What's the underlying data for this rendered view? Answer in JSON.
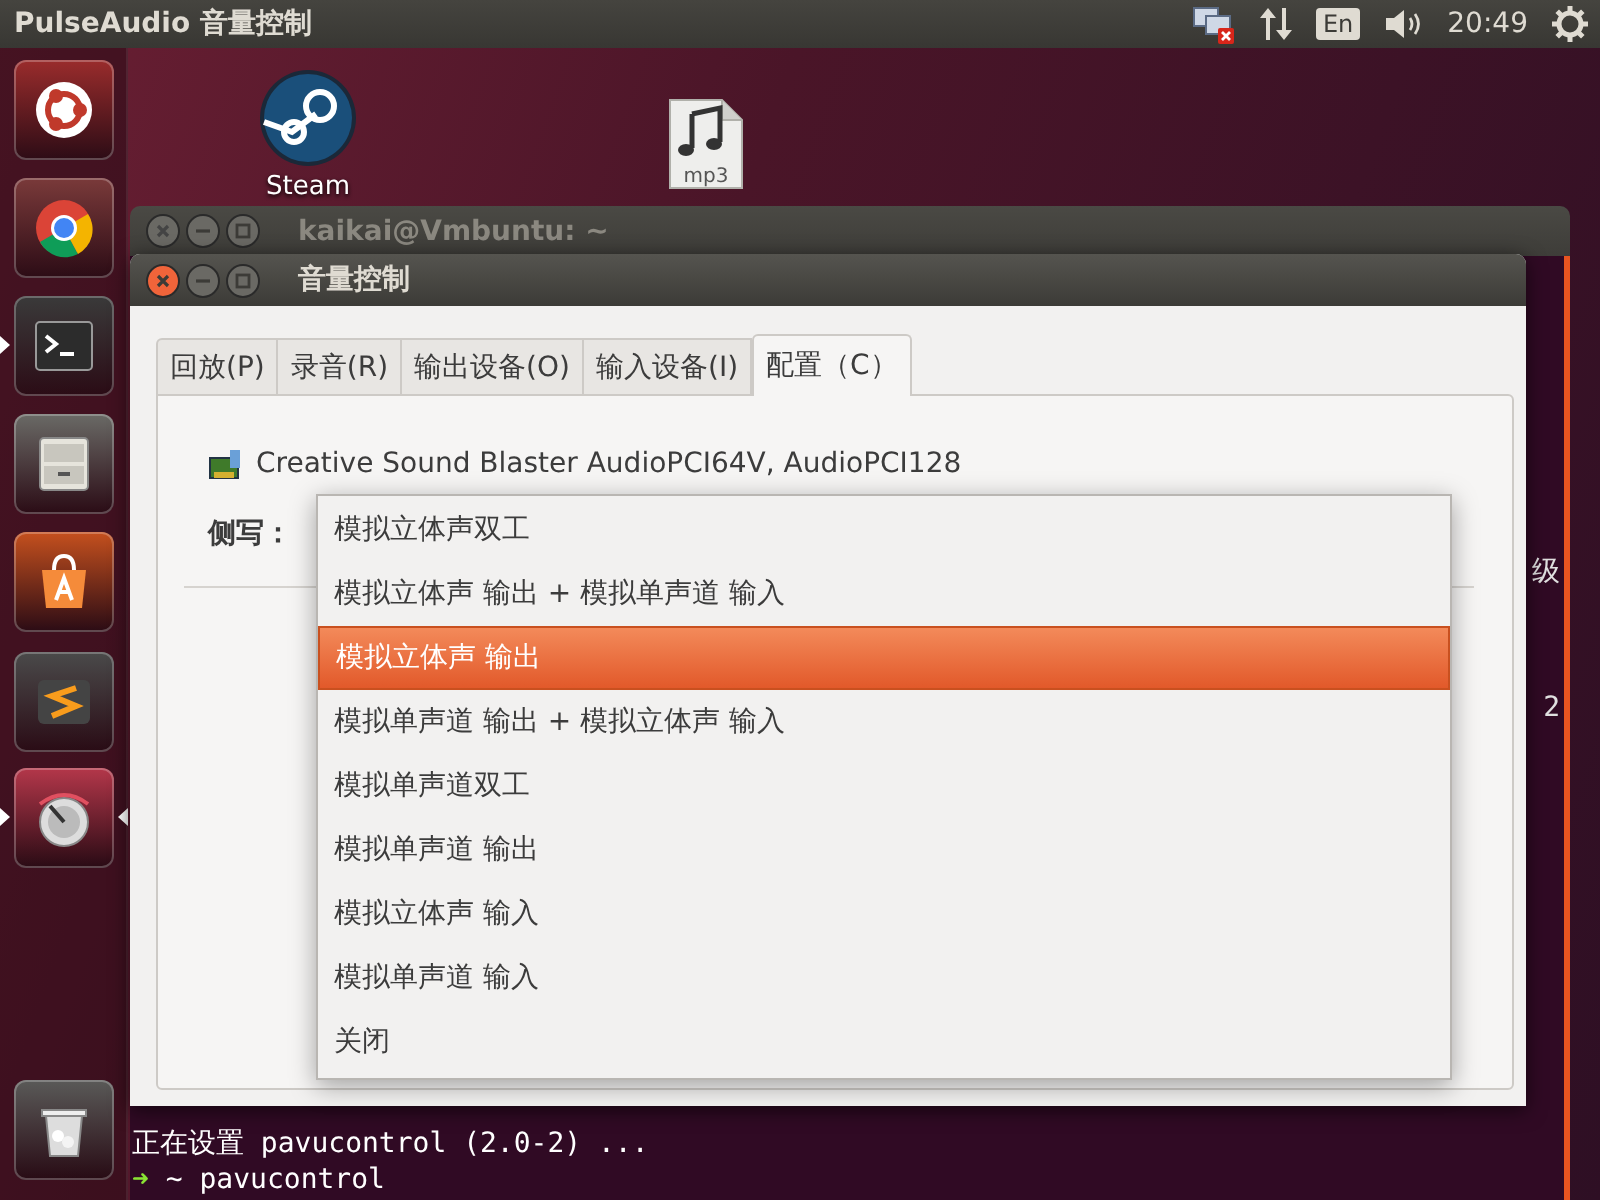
{
  "top_panel": {
    "title": "PulseAudio 音量控制",
    "keyboard": "En",
    "clock": "20:49"
  },
  "launcher": {
    "items": [
      {
        "kind": "dash",
        "running": false,
        "focused": false
      },
      {
        "kind": "browser",
        "running": false,
        "focused": false
      },
      {
        "kind": "terminal",
        "running": true,
        "focused": false
      },
      {
        "kind": "files",
        "running": false,
        "focused": false
      },
      {
        "kind": "software",
        "running": false,
        "focused": false
      },
      {
        "kind": "editor",
        "running": false,
        "focused": false
      },
      {
        "kind": "mixer",
        "running": true,
        "focused": true
      }
    ],
    "trash": {
      "kind": "trash"
    }
  },
  "desktop_icons": [
    {
      "kind": "steam",
      "label": "Steam"
    },
    {
      "kind": "audio-file",
      "badge": "mp3"
    }
  ],
  "terminal": {
    "title": "kaikai@Vmbuntu: ~",
    "side_texts": [
      "级",
      "2"
    ],
    "lines": [
      {
        "kind": "output",
        "text": "正在设置 pavucontrol (2.0-2) ..."
      },
      {
        "kind": "prompt",
        "arrow": "➜",
        "dir": "~",
        "text": "pavucontrol"
      }
    ]
  },
  "dialog": {
    "title": "音量控制",
    "tabs": [
      {
        "label": "回放(P)",
        "selected": false
      },
      {
        "label": "录音(R)",
        "selected": false
      },
      {
        "label": "输出设备(O)",
        "selected": false
      },
      {
        "label": "输入设备(I)",
        "selected": false
      },
      {
        "label": "配置（C）",
        "selected": true
      }
    ],
    "card": {
      "name": "Creative Sound Blaster AudioPCI64V, AudioPCI128"
    },
    "profile_label": "侧写：",
    "menu": {
      "items": [
        {
          "label": "模拟立体声双工",
          "selected": false
        },
        {
          "label": "模拟立体声 输出 + 模拟单声道 输入",
          "selected": false
        },
        {
          "label": "模拟立体声 输出",
          "selected": true
        },
        {
          "label": "模拟单声道 输出 + 模拟立体声 输入",
          "selected": false
        },
        {
          "label": "模拟单声道双工",
          "selected": false
        },
        {
          "label": "模拟单声道 输出",
          "selected": false
        },
        {
          "label": "模拟立体声 输入",
          "selected": false
        },
        {
          "label": "模拟单声道 输入",
          "selected": false
        },
        {
          "label": "关闭",
          "selected": false
        }
      ]
    }
  }
}
